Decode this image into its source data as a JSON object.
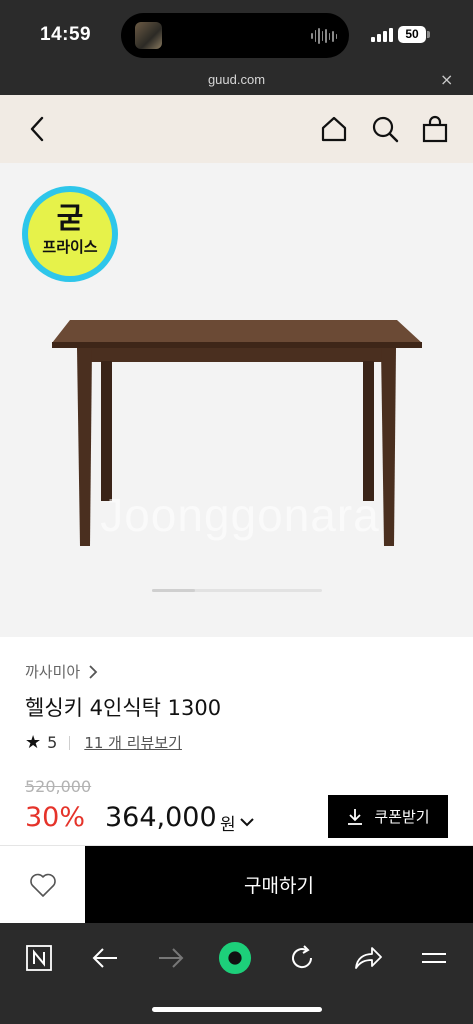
{
  "status_bar": {
    "time": "14:59",
    "battery": "50"
  },
  "browser": {
    "url": "guud.com",
    "close_symbol": "×"
  },
  "product": {
    "badge_main": "굳",
    "badge_sub": "프라이스",
    "watermark": "Joonggonara",
    "brand": "까사미아",
    "title": "헬싱키 4인식탁 1300",
    "rating": "5",
    "review_link": "11 개 리뷰보기",
    "original_price": "520,000",
    "discount_rate": "30%",
    "sale_price": "364,000",
    "price_unit": "원",
    "coupon_label": "쿠폰받기",
    "buy_label": "구매하기",
    "carousel_progress": 0.25
  },
  "icons": {
    "header": [
      "back-icon",
      "home-icon",
      "search-icon",
      "bag-icon"
    ],
    "toolbar": [
      "naver-n-icon",
      "back-arrow-icon",
      "forward-arrow-icon",
      "green-dot-icon",
      "reload-icon",
      "share-icon",
      "menu-icon"
    ]
  },
  "colors": {
    "discount": "#e5332a",
    "badge_ring": "#2ec6ea",
    "badge_fill": "#e6f24a",
    "accent_green": "#1dcf7a"
  }
}
